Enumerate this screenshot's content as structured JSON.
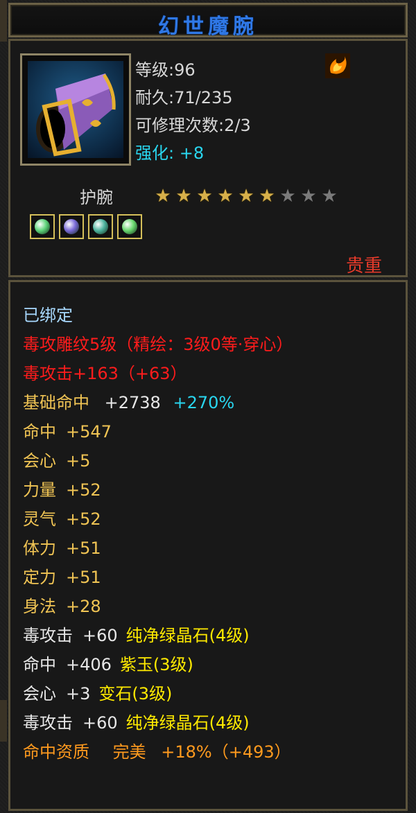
{
  "title": "幻世魔腕",
  "item": {
    "level_label": "等级:96",
    "durability_label": "耐久:71/235",
    "repair_label": "可修理次数:2/3",
    "enhance_label": "强化: +8",
    "type": "护腕",
    "stars_filled": 6,
    "stars_total": 9,
    "rarity": "贵重",
    "gems": [
      {
        "icon": "green-gem-icon",
        "color": "#5fd47a"
      },
      {
        "icon": "purple-gem-icon",
        "color": "#7a6bd8"
      },
      {
        "icon": "teal-gem-icon",
        "color": "#4fb4a0"
      },
      {
        "icon": "green-gem-icon",
        "color": "#6ad86f"
      }
    ]
  },
  "details": {
    "bound": "已绑定",
    "engrave": "毒攻雕纹5级（精绘：3级0等·穿心）",
    "poison_attack": "毒攻击+163（+63）",
    "base_hit_label": "基础命中",
    "base_hit_value": "+2738",
    "base_hit_pct": "+270%",
    "stats": [
      {
        "name": "命中",
        "value": "+547"
      },
      {
        "name": "会心",
        "value": "+5"
      },
      {
        "name": "力量",
        "value": "+52"
      },
      {
        "name": "灵气",
        "value": "+52"
      },
      {
        "name": "体力",
        "value": "+51"
      },
      {
        "name": "定力",
        "value": "+51"
      },
      {
        "name": "身法",
        "value": "+28"
      }
    ],
    "gem_stats": [
      {
        "stat": "毒攻击",
        "value": "+60",
        "gem": "纯净绿晶石(4级)"
      },
      {
        "stat": "命中",
        "value": "+406",
        "gem": "紫玉(3级)"
      },
      {
        "stat": "会心",
        "value": "+3",
        "gem": "变石(3级)"
      },
      {
        "stat": "毒攻击",
        "value": "+60",
        "gem": "纯净绿晶石(4级)"
      }
    ],
    "quality_label": "命中资质",
    "quality_grade": "完美",
    "quality_bonus": "+18%（+493）"
  },
  "colors": {
    "title": "#2f78e6",
    "enhance": "#29d6ef",
    "rarity": "#e53a2a",
    "red_stats": "#ff1c1c",
    "gold_stats": "#f0c454",
    "gem_name": "#ffea00",
    "quality": "#ff9a1e"
  }
}
